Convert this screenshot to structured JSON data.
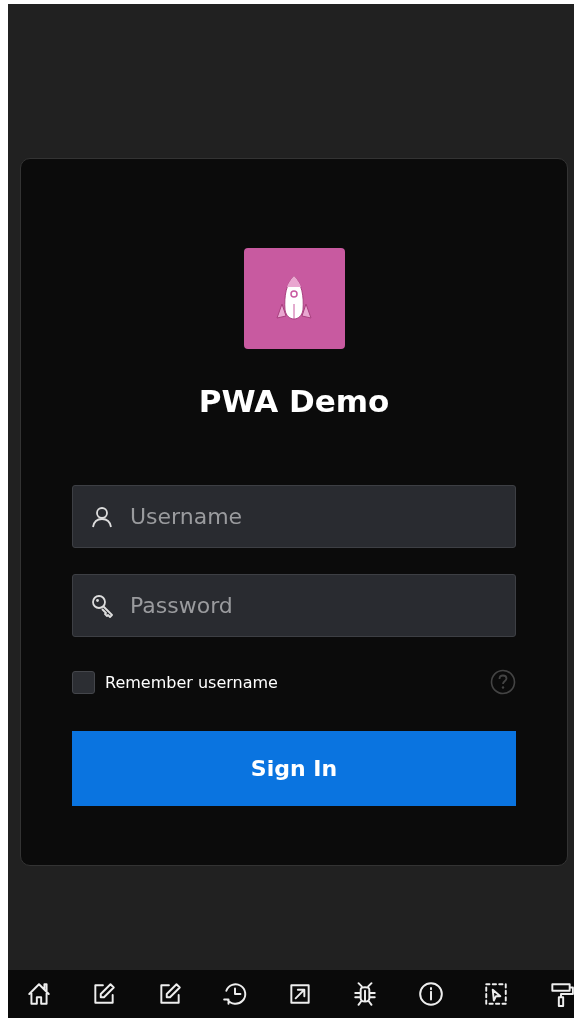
{
  "app": {
    "title": "PWA Demo"
  },
  "username": {
    "placeholder": "Username"
  },
  "password": {
    "placeholder": "Password"
  },
  "remember": {
    "label": "Remember username",
    "checked": false
  },
  "sign_in": {
    "label": "Sign In"
  }
}
